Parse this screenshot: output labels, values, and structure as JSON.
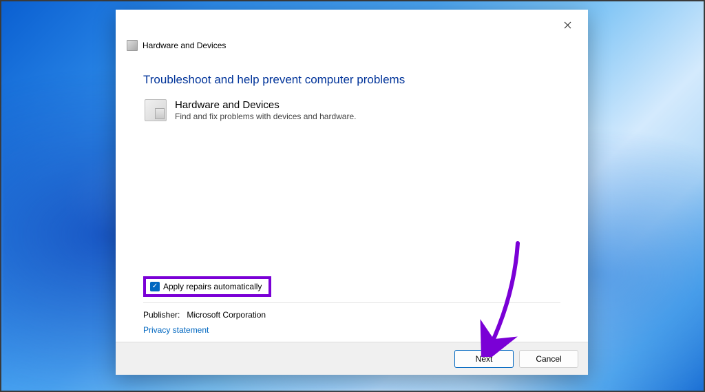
{
  "dialog": {
    "header_title": "Hardware and Devices",
    "instruction": "Troubleshoot and help prevent computer problems",
    "troubleshooter": {
      "title": "Hardware and Devices",
      "subtitle": "Find and fix problems with devices and hardware."
    },
    "checkbox_label": "Apply repairs automatically",
    "checkbox_checked": true,
    "publisher_label": "Publisher:",
    "publisher_value": "Microsoft Corporation",
    "privacy_link": "Privacy statement",
    "buttons": {
      "next": "Next",
      "cancel": "Cancel"
    }
  },
  "annotation": {
    "highlight_color": "#7a00d6"
  }
}
